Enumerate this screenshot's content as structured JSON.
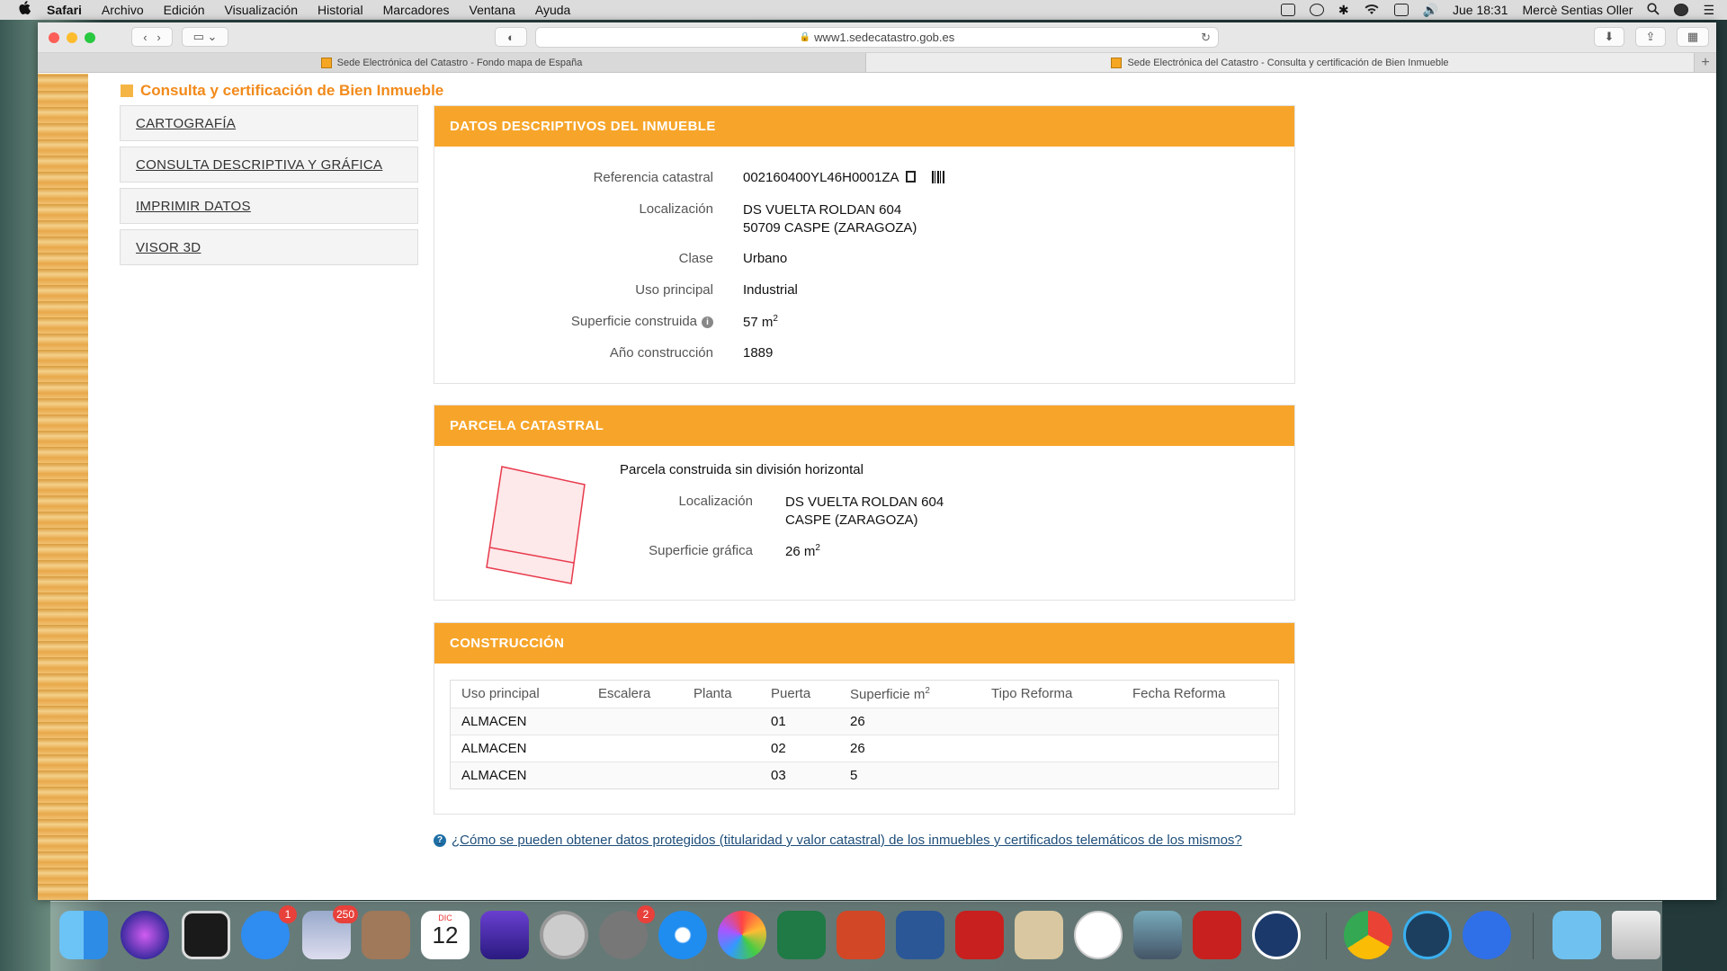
{
  "menubar": {
    "apple": "",
    "items": [
      "Safari",
      "Archivo",
      "Edición",
      "Visualización",
      "Historial",
      "Marcadores",
      "Ventana",
      "Ayuda"
    ],
    "clock": "Jue 18:31",
    "user": "Mercè Sentias Oller"
  },
  "browser": {
    "url": "www1.sedecatastro.gob.es",
    "tabs": [
      {
        "title": "Sede Electrónica del Catastro - Fondo mapa de España",
        "active": false
      },
      {
        "title": "Sede Electrónica del Catastro - Consulta y certificación de Bien Inmueble",
        "active": true
      }
    ]
  },
  "page": {
    "title": "Consulta y certificación de Bien Inmueble",
    "nav": [
      "CARTOGRAFÍA",
      "CONSULTA DESCRIPTIVA Y GRÁFICA",
      "IMPRIMIR DATOS",
      "VISOR 3D"
    ],
    "descriptivos": {
      "header": "DATOS DESCRIPTIVOS DEL INMUEBLE",
      "ref_label": "Referencia catastral",
      "ref_value": "002160400YL46H0001ZA",
      "loc_label": "Localización",
      "loc_line1": "DS VUELTA ROLDAN 604",
      "loc_line2": "50709 CASPE (ZARAGOZA)",
      "clase_label": "Clase",
      "clase_value": "Urbano",
      "uso_label": "Uso principal",
      "uso_value": "Industrial",
      "sup_label": "Superficie construida",
      "sup_value": "57 m",
      "sup_sup": "2",
      "anio_label": "Año construcción",
      "anio_value": "1889"
    },
    "parcela": {
      "header": "PARCELA CATASTRAL",
      "desc": "Parcela construida sin división horizontal",
      "loc_label": "Localización",
      "loc_line1": "DS VUELTA ROLDAN 604",
      "loc_line2": "CASPE (ZARAGOZA)",
      "sup_label": "Superficie gráfica",
      "sup_value": "26 m",
      "sup_sup": "2"
    },
    "construccion": {
      "header": "CONSTRUCCIÓN",
      "columns": [
        "Uso principal",
        "Escalera",
        "Planta",
        "Puerta",
        "Superficie m",
        "Tipo Reforma",
        "Fecha Reforma"
      ],
      "sup_col_sup": "2",
      "rows": [
        [
          "ALMACEN",
          "",
          "",
          "01",
          "26",
          "",
          ""
        ],
        [
          "ALMACEN",
          "",
          "",
          "02",
          "26",
          "",
          ""
        ],
        [
          "ALMACEN",
          "",
          "",
          "03",
          "5",
          "",
          ""
        ]
      ]
    },
    "help_link": "¿Cómo se pueden obtener datos protegidos (titularidad y valor catastral) de los inmuebles y certificados telemáticos de los mismos?"
  },
  "dock": {
    "badges": {
      "appstore": "1",
      "mail": "250",
      "calendar_month": "DIC",
      "calendar_day": "12",
      "sysprefs": "2"
    }
  },
  "colors": {
    "accent": "#f7a52a",
    "title": "#f28a1a",
    "link": "#1e4e7a"
  }
}
